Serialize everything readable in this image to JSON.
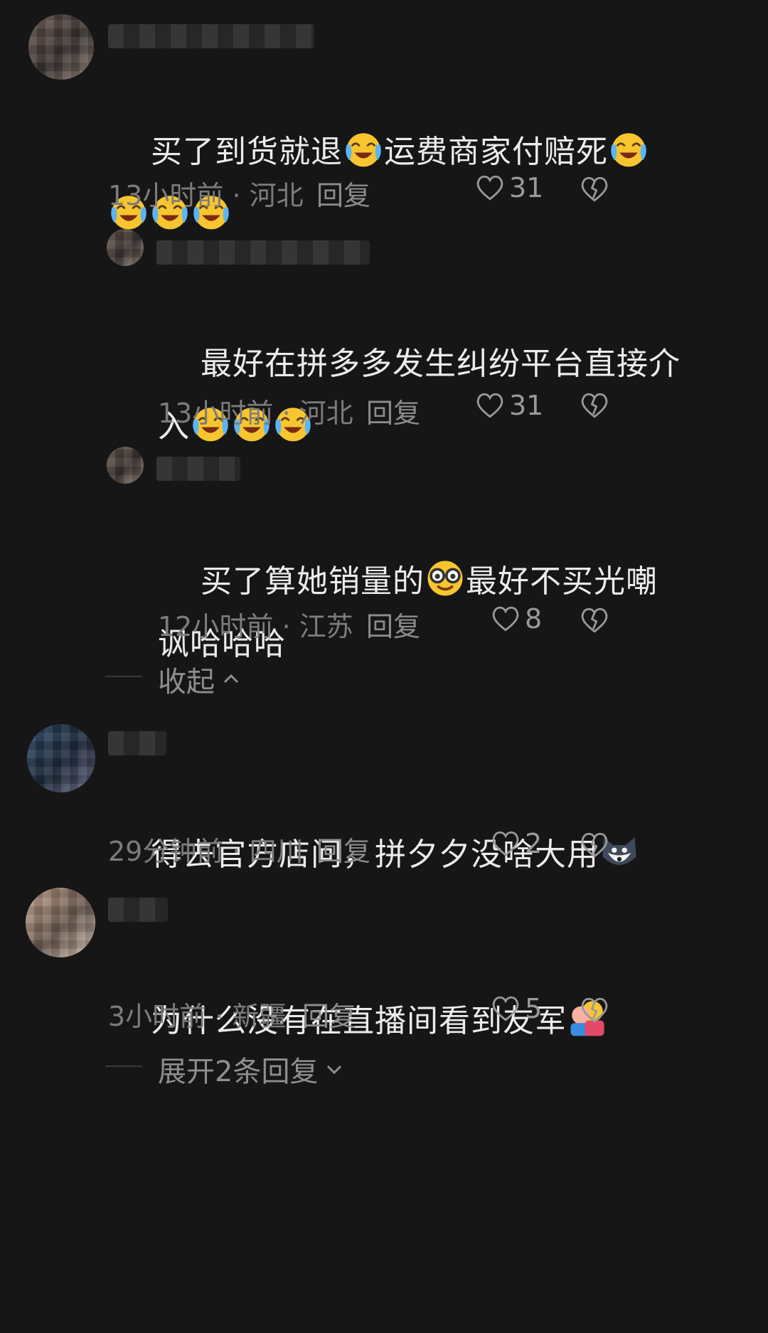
{
  "comments": [
    {
      "text_line1": "买了到货就退",
      "text_line1b": "运费商家付赔死",
      "time": "13小时前",
      "location": "河北",
      "reply_label": "回复",
      "likes": "31"
    },
    {
      "text_line1": "最好在拼多多发生纠纷平台直接介",
      "text_line2": "入",
      "time": "13小时前",
      "location": "河北",
      "reply_label": "回复",
      "likes": "31"
    },
    {
      "text_line1a": "买了算她销量的",
      "text_line1b": "最好不买光嘲",
      "text_line2": "讽哈哈哈",
      "time": "12小时前",
      "location": "江苏",
      "reply_label": "回复",
      "likes": "8"
    },
    {
      "text_line1": "得去官方店问，拼夕夕没啥大用",
      "time": "29分钟前",
      "location": "四川",
      "reply_label": "回复",
      "likes": "2"
    },
    {
      "text_line1": "为什么没有在直播间看到友军",
      "time": "3小时前",
      "location": "新疆",
      "reply_label": "回复",
      "likes": "5"
    }
  ],
  "collapse_label": "收起",
  "expand_label": "展开2条回复",
  "separator": " · ",
  "icons": {
    "crying": "crying-laughing-emoji",
    "nerd": "nerd-face-emoji",
    "dog": "husky-dog-emoji",
    "hug": "hugging-people-emoji",
    "heart": "heart-outline-icon",
    "broken_heart": "broken-heart-icon",
    "chevron_up": "chevron-up-icon",
    "chevron_down": "chevron-down-icon"
  }
}
